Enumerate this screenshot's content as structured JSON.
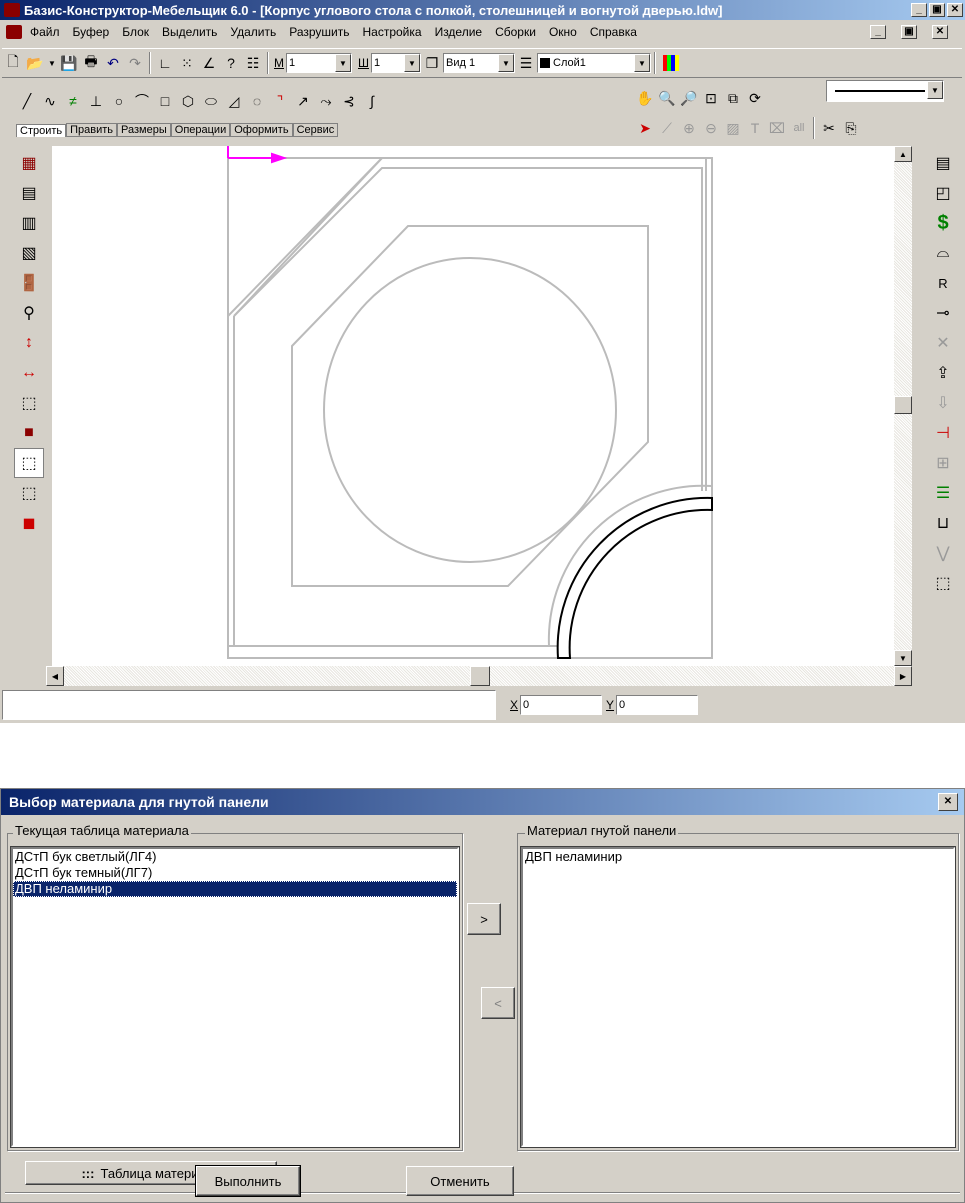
{
  "app": {
    "title": "Базис-Конструктор-Мебельщик 6.0 - [Корпус углового стола с полкой, столешницей и вогнутой дверью.ldw]",
    "menu": [
      "Файл",
      "Буфер",
      "Блок",
      "Выделить",
      "Удалить",
      "Разрушить",
      "Настройка",
      "Изделие",
      "Сборки",
      "Окно",
      "Справка"
    ],
    "controls": {
      "minimize": "_",
      "restore": "▣",
      "close": "✕"
    },
    "toolbar": {
      "m_label": "М",
      "m_value": "1",
      "w_label": "Ш",
      "w_value": "1",
      "view_value": "Вид 1",
      "layer_value": "Слой1"
    },
    "tabs": [
      "Строить",
      "Править",
      "Размеры",
      "Операции",
      "Оформить",
      "Сервис"
    ],
    "status": {
      "x_label": "X",
      "x_value": "0",
      "y_label": "Y",
      "y_value": "0"
    },
    "colors": {
      "title_start": "#0a246a",
      "title_end": "#a6caf0",
      "axis": "#ff00ff",
      "face": "#d4d0c8"
    }
  },
  "dialog": {
    "title": "Выбор материала для гнутой панели",
    "close": "✕",
    "left_group": "Текущая таблица материала",
    "left_items": [
      "ДСтП бук светлый(ЛГ4)",
      "ДСтП бук темный(ЛГ7)",
      "ДВП неламинир"
    ],
    "selected_index": 2,
    "right_group": "Материал гнутой панели",
    "right_items": [
      "ДВП неламинир"
    ],
    "move_right": ">",
    "move_left": "<",
    "table_button": "Таблица материала",
    "table_button_icon": ":::",
    "ok_button": "Выполнить",
    "cancel_button": "Отменить"
  }
}
